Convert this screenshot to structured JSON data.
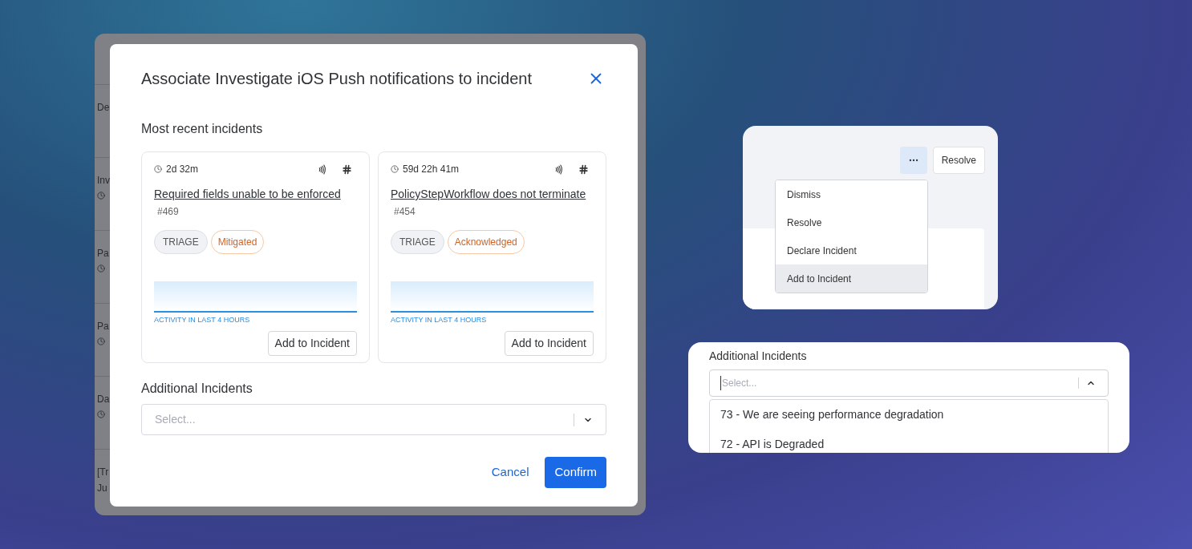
{
  "background_rows": [
    {
      "title": "De",
      "clock": false
    },
    {
      "title": "Inv",
      "clock": true
    },
    {
      "title": "Pa",
      "clock": true
    },
    {
      "title": "Pa",
      "clock": true
    },
    {
      "title": "Da",
      "clock": true
    },
    {
      "title": "[Tr",
      "clock": false,
      "subtitle": "Ju"
    }
  ],
  "modal": {
    "title": "Associate Investigate iOS Push notifications to incident",
    "section_title": "Most recent incidents",
    "incidents": [
      {
        "age": "2d 32m",
        "title": "Required fields unable to be enforced",
        "number": "#469",
        "tags": [
          {
            "label": "TRIAGE",
            "kind": "phase"
          },
          {
            "label": "Mitigated",
            "kind": "status"
          }
        ],
        "activity_label": "ACTIVITY IN LAST 4 HOURS",
        "button": "Add to Incident"
      },
      {
        "age": "59d 22h 41m",
        "title": "PolicyStepWorkflow does not terminate",
        "number": "#454",
        "tags": [
          {
            "label": "TRIAGE",
            "kind": "phase"
          },
          {
            "label": "Acknowledged",
            "kind": "status"
          }
        ],
        "activity_label": "ACTIVITY IN LAST 4 HOURS",
        "button": "Add to Incident"
      }
    ],
    "additional_label": "Additional Incidents",
    "select": {
      "placeholder": "Select...",
      "expanded": false
    },
    "cancel": "Cancel",
    "confirm": "Confirm"
  },
  "actions_card": {
    "resolve_button": "Resolve",
    "menu": [
      {
        "label": "Dismiss",
        "selected": false
      },
      {
        "label": "Resolve",
        "selected": false
      },
      {
        "label": "Declare Incident",
        "selected": false
      },
      {
        "label": "Add to Incident",
        "selected": true
      }
    ]
  },
  "select_card": {
    "label": "Additional Incidents",
    "placeholder": "Select...",
    "expanded": true,
    "options": [
      {
        "label": "73 - We are seeing performance degradation"
      },
      {
        "label": "72 - API is Degraded"
      }
    ]
  }
}
